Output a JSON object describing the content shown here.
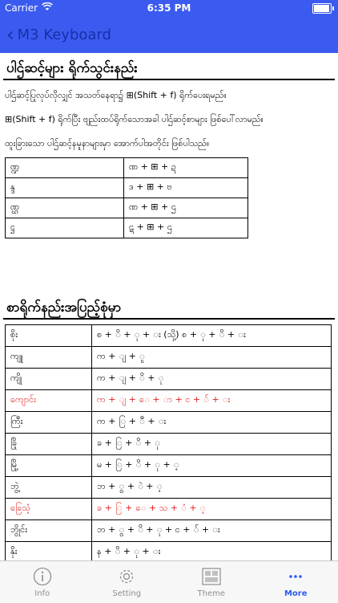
{
  "status": {
    "carrier": "Carrier",
    "time": "6:35 PM"
  },
  "nav": {
    "back_label": "M3 Keyboard"
  },
  "section1": {
    "title": "ပါဌ်ဆင့်များ ရိုက်သွင်းနည်း",
    "para1": "ပါဌ်ဆင့်ပြုလုပ်လိုလျှင် အသတ်နေရာ၌ ⊞(Shift + f) ရိုက်ပေးရမည်။",
    "para2": "⊞(Shift + f) ရိုက်ပြီး ဗျည်းထပ်ရိုက်သောအခါ ပါဌ်ဆင့်စာများ ဖြစ်ပေါ်လာမည်။",
    "para3": "ထူးခြားသော ပါဌ်ဆင့်နမူနာများမှာ အောက်ပါအတိုင်း ဖြစ်ပါသည်။",
    "rows": [
      {
        "a": "ဏ္ဍ",
        "b": "ဏ + ⊞ + ဍ"
      },
      {
        "a": "န္ဒ",
        "b": "ဒ + ⊞ + ဗ"
      },
      {
        "a": "ဏ္ဌ",
        "b": "ဏ + ⊞ + ဌ"
      },
      {
        "a": "ဋ္ဌ",
        "b": "ဋ + ⊞ + ဌ"
      }
    ]
  },
  "section2": {
    "title": "စာရိုက်နည်းအပြည့်စုံမှာ",
    "rows": [
      {
        "a": "စိုး",
        "b": "စ + ိ + ု + း (သို့) စ + ု + ိ + း",
        "red": false
      },
      {
        "a": "ကျူ",
        "b": "က + ျ + ူ",
        "red": false
      },
      {
        "a": "ကျို",
        "b": "က + ျ + ိ + ု",
        "red": false
      },
      {
        "a": "ကျောင်း",
        "b": "က + ျ + ေ + ာ + င + ် + း",
        "red": true
      },
      {
        "a": "ကြီး",
        "b": "က + ြ + ီ + း",
        "red": false
      },
      {
        "a": "ခြို",
        "b": "ခ + ြ + ိ + ု",
        "red": false
      },
      {
        "a": "မြို့",
        "b": "မ + ြ + ိ + ု + ့",
        "red": false
      },
      {
        "a": "ဘွဲ့",
        "b": "ဘ + ွ + ဲ + ့",
        "red": false
      },
      {
        "a": "ခြေသံ့",
        "b": "ခ + ြ + ေ + သ + ံ + ့",
        "red": true
      },
      {
        "a": "ဘွိုင်း",
        "b": "ဘ + ွ + ိ + ု + င + ် + း",
        "red": false
      },
      {
        "a": "နိုး",
        "b": "န + ိ + ု + း",
        "red": false
      }
    ]
  },
  "tabs": [
    {
      "label": "Info",
      "icon": "info-icon"
    },
    {
      "label": "Setting",
      "icon": "gear-icon"
    },
    {
      "label": "Theme",
      "icon": "theme-icon"
    },
    {
      "label": "More",
      "icon": "more-icon"
    }
  ]
}
